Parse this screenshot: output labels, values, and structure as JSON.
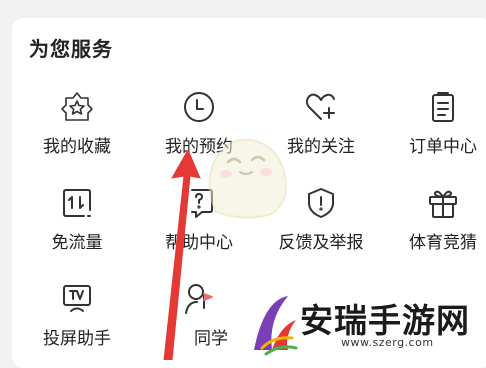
{
  "section": {
    "title": "为您服务",
    "items": [
      {
        "label": "我的收藏",
        "icon": "star-badge-icon"
      },
      {
        "label": "我的预约",
        "icon": "clock-icon"
      },
      {
        "label": "我的关注",
        "icon": "heart-plus-icon"
      },
      {
        "label": "订单中心",
        "icon": "clipboard-icon"
      },
      {
        "label": "免流量",
        "icon": "data-transfer-icon"
      },
      {
        "label": "帮助中心",
        "icon": "help-icon"
      },
      {
        "label": "反馈及举报",
        "icon": "shield-alert-icon"
      },
      {
        "label": "体育竞猜",
        "icon": "gift-icon"
      },
      {
        "label": "投屏助手",
        "icon": "tv-cast-icon"
      },
      {
        "label": "同学",
        "icon": "classmate-icon"
      }
    ]
  },
  "annotation": {
    "arrow_color": "#e53935"
  },
  "watermark": {
    "text": "安瑞手游网",
    "url": "www.szerg.com"
  }
}
